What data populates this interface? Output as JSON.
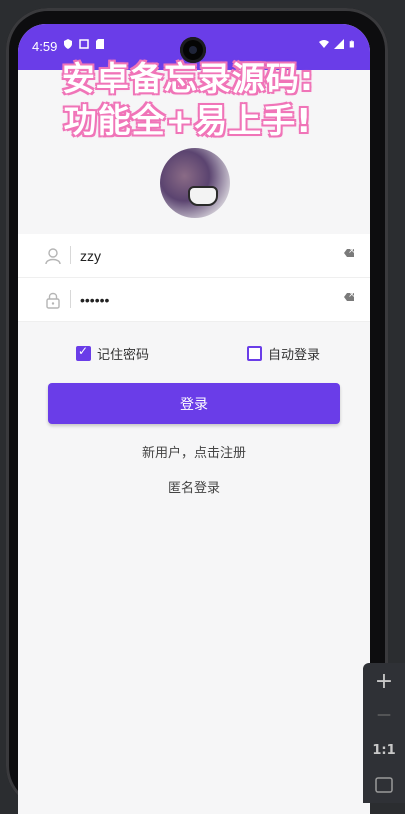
{
  "status_bar": {
    "time": "4:59",
    "left_icons": [
      "shield-icon",
      "screen-icon",
      "sd-card-icon"
    ],
    "right_icons": [
      "wifi-icon",
      "signal-icon",
      "battery-icon"
    ]
  },
  "overlay": {
    "line1": "安卓备忘录源码:",
    "line2": "功能全+易上手!"
  },
  "form": {
    "username_value": "zzy",
    "password_value": "••••••"
  },
  "options": {
    "remember_password": {
      "label": "记住密码",
      "checked": true
    },
    "auto_login": {
      "label": "自动登录",
      "checked": false
    }
  },
  "login_button": "登录",
  "register_link": "新用户，点击注册",
  "anonymous_link": "匿名登录",
  "zoom_panel": {
    "zoom_in": "+",
    "zoom_out": "—",
    "ratio": "1:1"
  },
  "colors": {
    "accent": "#6a3de8",
    "overlay_stroke": "#f075b8"
  }
}
